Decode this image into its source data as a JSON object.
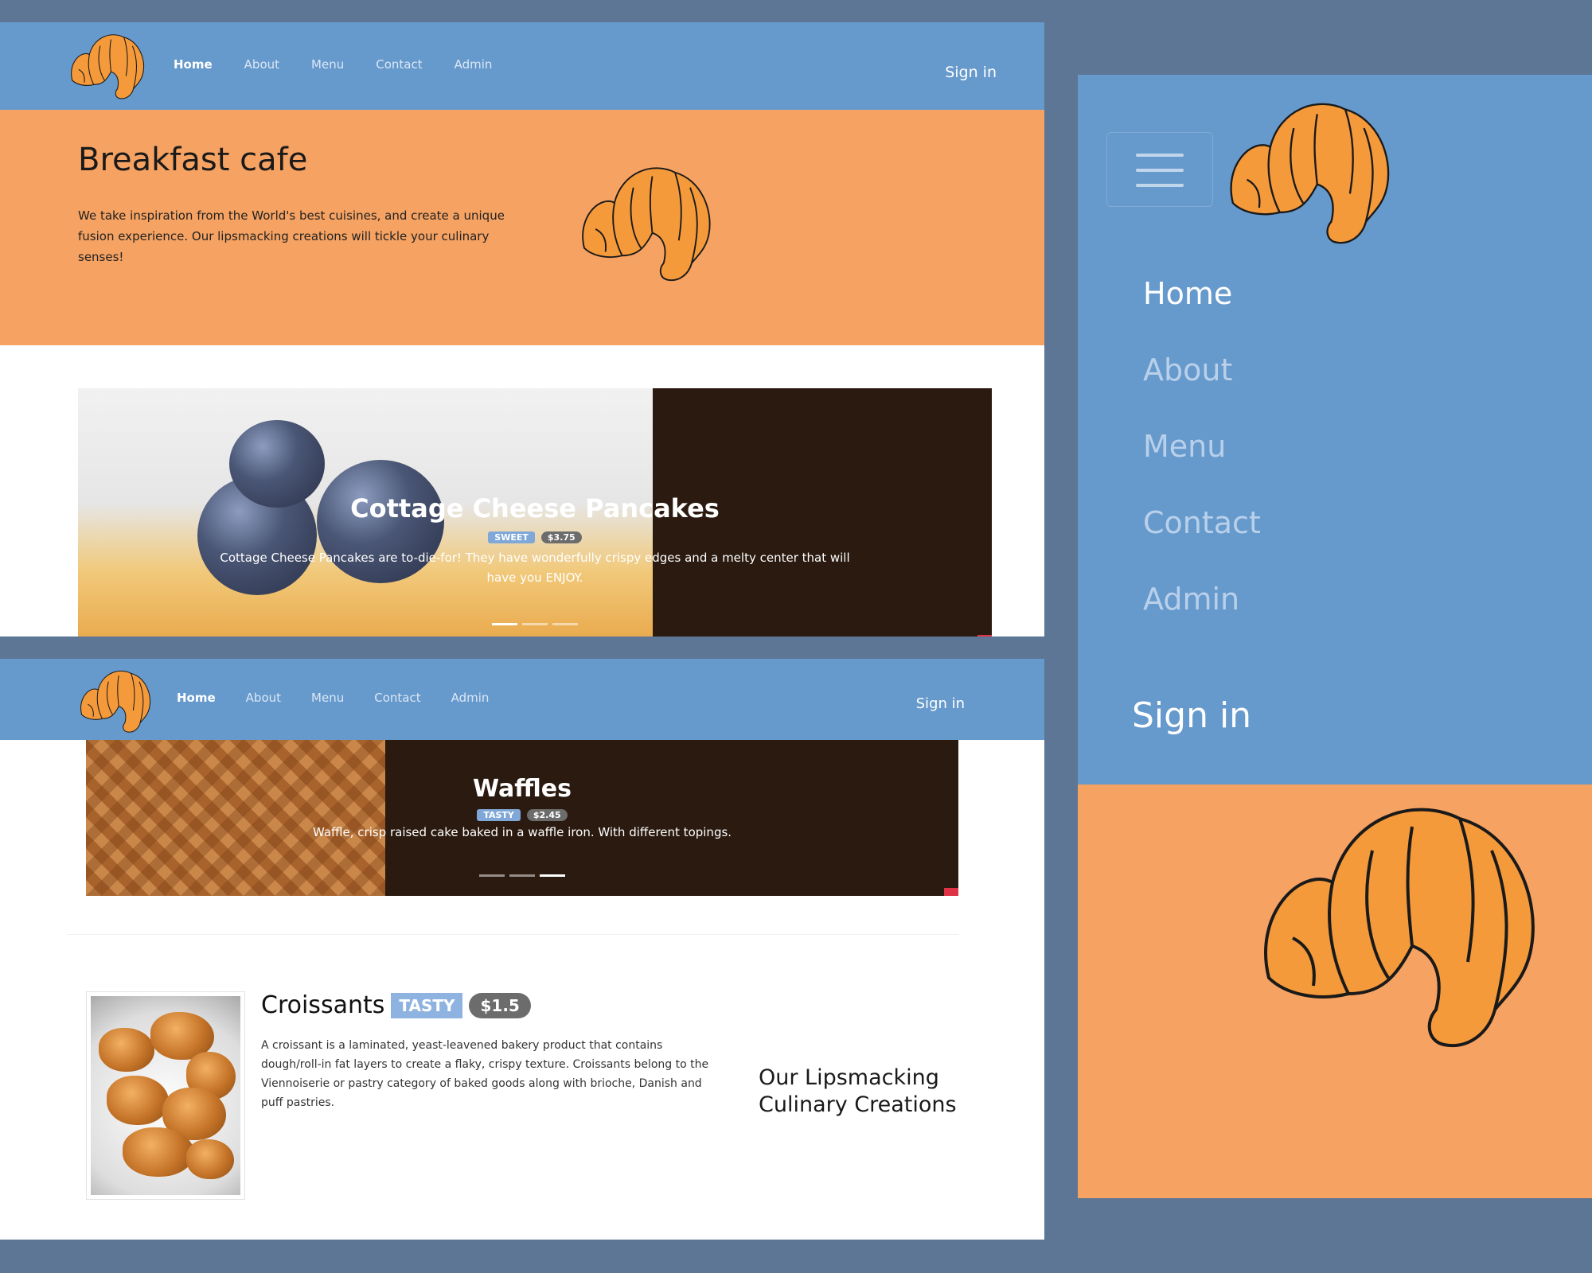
{
  "desktop": {
    "nav": {
      "items": [
        {
          "label": "Home"
        },
        {
          "label": "About"
        },
        {
          "label": "Menu"
        },
        {
          "label": "Contact"
        },
        {
          "label": "Admin"
        }
      ],
      "signin": "Sign in"
    },
    "hero": {
      "title": "Breakfast cafe",
      "text": "We take inspiration from the World's best cuisines, and create a unique fusion experience. Our lipsmacking creations will tickle your culinary senses!"
    },
    "carousel_slide_1": {
      "title": "Cottage Cheese Pancakes",
      "badge_tag": "SWEET",
      "badge_price": "$3.75",
      "description": "Cottage Cheese Pancakes are to-die-for! They have wonderfully crispy edges and a melty center that will have you ENJOY.",
      "active_indicator": 1
    },
    "carousel_slide_2": {
      "title": "Waffles",
      "badge_tag": "TASTY",
      "badge_price": "$2.45",
      "description": "Waffle, crisp raised cake baked in a waffle iron. With different topings.",
      "active_indicator": 3
    },
    "product": {
      "title": "Croissants",
      "badge_tag": "TASTY",
      "badge_price": "$1.5",
      "description": "A croissant is a laminated, yeast-leavened bakery product that contains dough/roll-in fat layers to create a flaky, crispy texture. Croissants belong to the Viennoiserie or pastry category of baked goods along with brioche, Danish and puff pastries."
    },
    "side_heading": "Our Lipsmacking Culinary Creations"
  },
  "mobile": {
    "nav": {
      "items": [
        {
          "label": "Home"
        },
        {
          "label": "About"
        },
        {
          "label": "Menu"
        },
        {
          "label": "Contact"
        },
        {
          "label": "Admin"
        }
      ],
      "signin": "Sign in"
    }
  },
  "colors": {
    "navbar": "#6699cc",
    "hero": "#f5a262",
    "carousel_bg": "#2a1a10",
    "page_bg": "#5d7696",
    "croissant_fill": "#f59a3a",
    "croissant_outline": "#1a1a1a"
  },
  "icons": {
    "logo": "croissant-logo-icon",
    "menu": "hamburger-menu-icon"
  }
}
